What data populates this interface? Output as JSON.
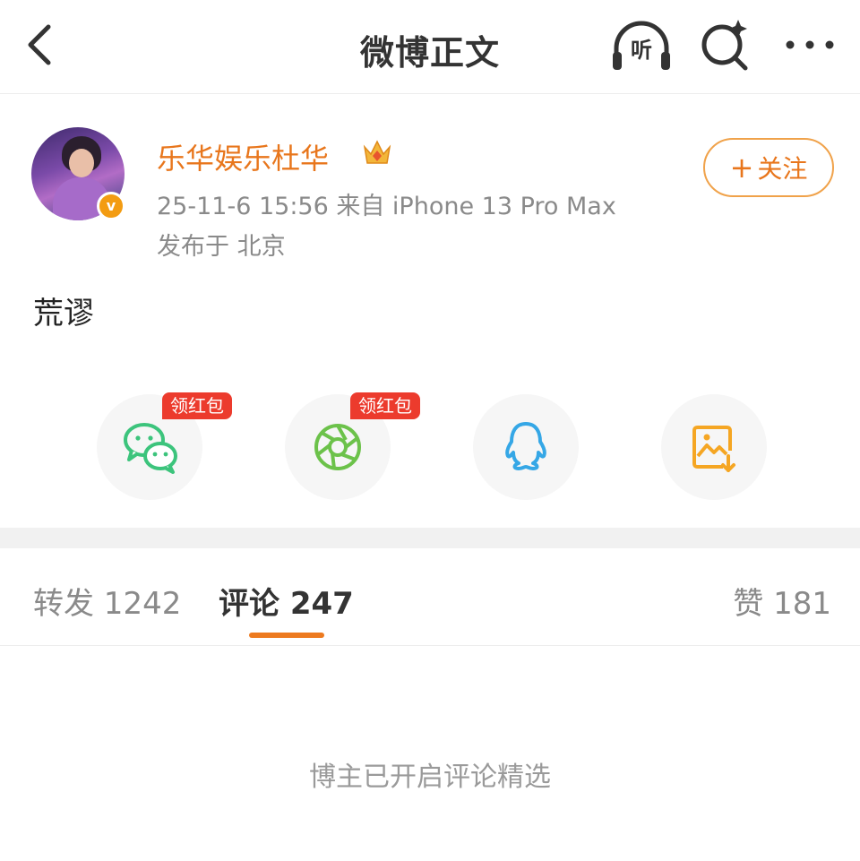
{
  "header": {
    "title": "微博正文",
    "listen_label": "听"
  },
  "author": {
    "name": "乐华娱乐杜华",
    "verified_mark": "v",
    "meta": "25-11-6 15:56  来自 iPhone 13 Pro Max",
    "location": "发布于 北京",
    "follow_plus": "+",
    "follow_label": "关注"
  },
  "post": {
    "text": "荒谬"
  },
  "share": {
    "items": [
      {
        "name": "wechat",
        "tag": "领红包",
        "icon": "wechat-icon"
      },
      {
        "name": "moments",
        "tag": "领红包",
        "icon": "moments-icon"
      },
      {
        "name": "qq",
        "icon": "qq-icon"
      },
      {
        "name": "save-image",
        "icon": "save-image-icon"
      }
    ]
  },
  "tabs": {
    "repost": "转发 1242",
    "comments": "评论 247",
    "likes": "赞 181"
  },
  "comments_notice": "博主已开启评论精选",
  "colors": {
    "accent": "#e8761c",
    "tag_red": "#ec3b2d",
    "wechat_green": "#3cc47c",
    "qq_blue": "#35a7e6",
    "save_orange": "#f5a623"
  }
}
